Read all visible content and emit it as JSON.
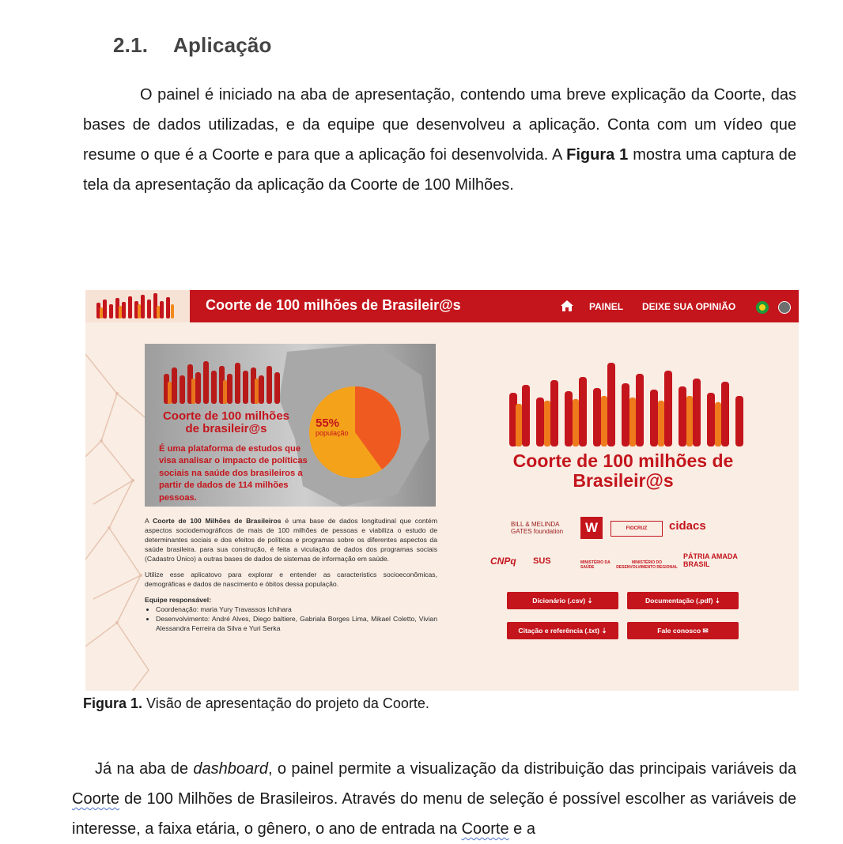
{
  "section": {
    "number": "2.1.",
    "title": "Aplicação"
  },
  "para1": {
    "text_a": "O painel é iniciado na aba de apresentação, contendo uma breve explicação da Coorte, das bases de dados utilizadas, e da equipe que desenvolveu a aplicação. Conta com um vídeo que resume o que é a Coorte e para que a aplicação foi desenvolvida. A ",
    "bold": "Figura 1",
    "text_b": " mostra uma captura de tela da apresentação da aplicação da Coorte de 100 Milhões."
  },
  "figure": {
    "header_title": "Coorte de 100 milhões de Brasileir@s",
    "nav_painel": "PAINEL",
    "nav_opiniao": "DEIXE SUA OPINIÃO",
    "hero_title": "Coorte de 100 milhões de brasileir@s",
    "hero_desc": "É uma plataforma de estudos que visa analisar o impacto de políticas sociais na saúde dos brasileiros a partir de dados de 114 milhões pessoas.",
    "pie_pct": "55%",
    "pie_label": "população",
    "body_p1_a": "A ",
    "body_p1_bold": "Coorte de 100 Milhões de Brasileiros",
    "body_p1_b": " é uma base de dados longitudinal que contém aspectos sociodemográficos de mais de 100 milhões de pessoas e viabiliza o estudo de determinantes sociais e dos efeitos de políticas e programas sobre os diferentes aspectos da saúde brasileira. para sua construção, é feita a viculação de dados dos programas sociais (Cadastro Único) a outras bases de dados de sistemas de informação em saúde.",
    "body_p2": "Utilize esse aplicatovo para explorar e entender as caracteristics socioeconômicas, demográficas e dados de nascimento e óbitos dessa população.",
    "team_label": "Equipe responsável:",
    "team_items": [
      "Coordenação: maria Yury Travassos Ichihara",
      "Desenvolvimento: André Alves, Diego baltiere, Gabriala Borges Lima, Mikael Coletto, Vivian Alessandra Ferreira da Silva e Yuri Serka"
    ],
    "big_title": "Coorte de 100 milhões de Brasileir@s",
    "sponsor_gates": "BILL & MELINDA GATES foundation",
    "sponsor_wellcome": "W",
    "sponsor_fiocruz": "FIOCRUZ",
    "sponsor_cidacs": "cidacs",
    "sponsor_cnpq": "CNPq",
    "sponsor_sus": "SUS",
    "sponsor_saude": "MINISTÉRIO DA SAÚDE",
    "sponsor_desenv": "MINISTÉRIO DO DESENVOLVIMENTO REGIONAL",
    "sponsor_brasil": "PÁTRIA AMADA BRASIL",
    "btn_dicionario": "Dicionário (.csv)",
    "btn_documentacao": "Documentação (.pdf)",
    "btn_citacao": "Citação e referência (.txt)",
    "btn_fale": "Fale conosco"
  },
  "caption": {
    "bold": "Figura 1.",
    "text": " Visão de apresentação do projeto da Coorte."
  },
  "para2": {
    "t1": "Já na aba de ",
    "italic": "dashboard",
    "t2": ", o painel permite a visualização da distribuição das principais variáveis da ",
    "coorte1": "Coorte",
    "t3": " de 100 Milhões de Brasileiros. Através do menu de seleção é possível escolher as  variáveis de interesse, a faixa etária, o gênero, o ano de entrada na ",
    "coorte2": "Coorte",
    "t4": " e a"
  }
}
